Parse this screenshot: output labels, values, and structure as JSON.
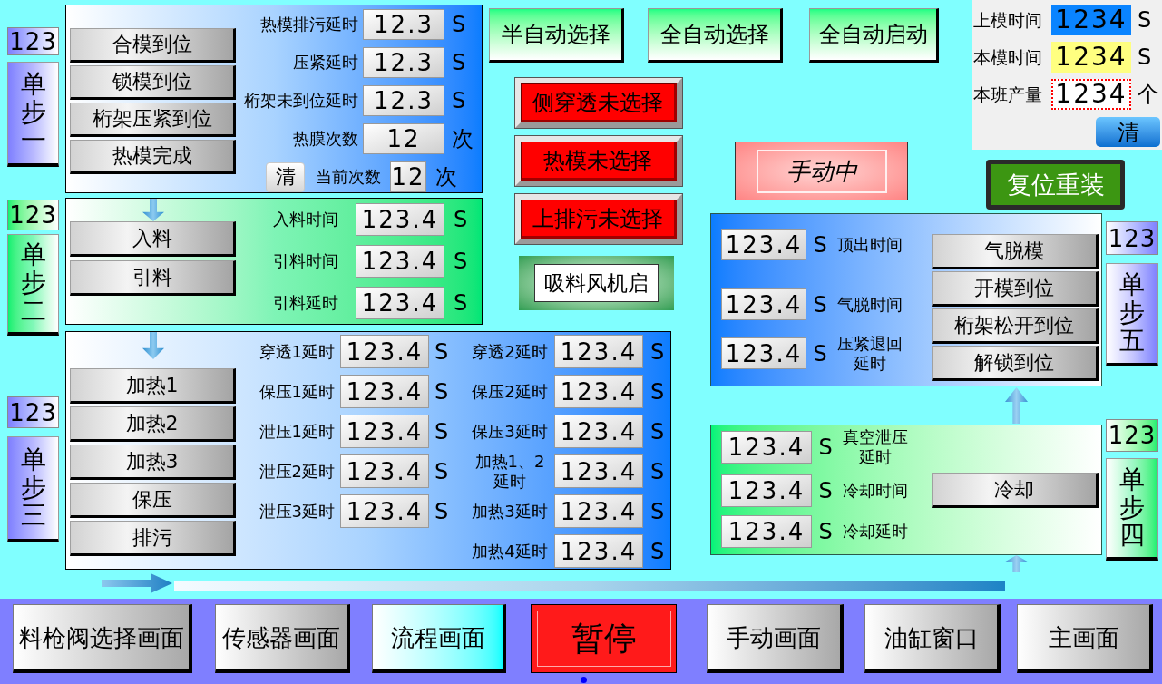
{
  "stage_1": {
    "step": {
      "display": "123",
      "label": "单步一"
    },
    "buttons": [
      "合模到位",
      "锁模到位",
      "桁架压紧到位",
      "热模完成"
    ],
    "params": [
      {
        "label": "热模排污延时",
        "value": "12.3",
        "unit": "S"
      },
      {
        "label": "压紧延时",
        "value": "12.3",
        "unit": "S"
      },
      {
        "label": "桁架未到位延时",
        "value": "12.3",
        "unit": "S"
      },
      {
        "label": "热膜次数",
        "value": "12",
        "unit": "次"
      }
    ],
    "counter": {
      "clear_button": "清",
      "label": "当前次数",
      "value": "12",
      "unit": "次"
    }
  },
  "stage_2": {
    "step": {
      "display": "123",
      "label": "单步二"
    },
    "buttons": [
      "入料",
      "引料"
    ],
    "params": [
      {
        "label": "入料时间",
        "value": "123.4",
        "unit": "S"
      },
      {
        "label": "引料时间",
        "value": "123.4",
        "unit": "S"
      },
      {
        "label": "引料延时",
        "value": "123.4",
        "unit": "S"
      }
    ]
  },
  "stage_3": {
    "step": {
      "display": "123",
      "label": "单步三"
    },
    "buttons": [
      "加热1",
      "加热2",
      "加热3",
      "保压",
      "排污"
    ],
    "params_left": [
      {
        "label": "穿透1延时",
        "value": "123.4",
        "unit": "S"
      },
      {
        "label": "保压1延时",
        "value": "123.4",
        "unit": "S"
      },
      {
        "label": "泄压1延时",
        "value": "123.4",
        "unit": "S"
      },
      {
        "label": "泄压2延时",
        "value": "123.4",
        "unit": "S"
      },
      {
        "label": "泄压3延时",
        "value": "123.4",
        "unit": "S"
      }
    ],
    "params_right": [
      {
        "label": "穿透2延时",
        "value": "123.4",
        "unit": "S"
      },
      {
        "label": "保压2延时",
        "value": "123.4",
        "unit": "S"
      },
      {
        "label": "保压3延时",
        "value": "123.4",
        "unit": "S"
      },
      {
        "label": "加热1、2延时",
        "value": "123.4",
        "unit": "S"
      },
      {
        "label": "加热3延时",
        "value": "123.4",
        "unit": "S"
      },
      {
        "label": "加热4延时",
        "value": "123.4",
        "unit": "S"
      }
    ]
  },
  "mode_buttons": [
    "半自动选择",
    "全自动选择",
    "全自动启动"
  ],
  "alarms": [
    "侧穿透未选择",
    "热模未选择",
    "上排污未选择"
  ],
  "fan_button": "吸料风机启",
  "status": "手动中",
  "production": {
    "rows": [
      {
        "label": "上模时间",
        "value": "1234",
        "unit": "S",
        "color": "#0a84ff",
        "focused": false
      },
      {
        "label": "本模时间",
        "value": "1234",
        "unit": "S",
        "color": "#ffff80",
        "focused": false
      },
      {
        "label": "本班产量",
        "value": "1234",
        "unit": "个",
        "color": "#ffffff",
        "focused": true
      }
    ],
    "clear_button": "清"
  },
  "reset_button": "复位重装",
  "stage_5": {
    "step": {
      "display": "123",
      "label": "单步五"
    },
    "params": [
      {
        "label": "顶出时间",
        "value": "123.4",
        "unit": "S"
      },
      {
        "label": "气脱时间",
        "value": "123.4",
        "unit": "S"
      },
      {
        "label": "压紧退回延时",
        "value": "123.4",
        "unit": "S"
      }
    ],
    "buttons": [
      "气脱模",
      "开模到位",
      "桁架松开到位",
      "解锁到位"
    ]
  },
  "stage_4": {
    "step": {
      "display": "123",
      "label": "单步四"
    },
    "params": [
      {
        "label": "真空泄压延时",
        "value": "123.4",
        "unit": "S"
      },
      {
        "label": "冷却时间",
        "value": "123.4",
        "unit": "S"
      },
      {
        "label": "冷却延时",
        "value": "123.4",
        "unit": "S"
      }
    ],
    "buttons": [
      "冷却"
    ]
  },
  "nav": [
    {
      "label": "料枪阀选择画面",
      "kind": "screen",
      "selected": false
    },
    {
      "label": "传感器画面",
      "kind": "screen",
      "selected": false
    },
    {
      "label": "流程画面",
      "kind": "screen",
      "selected": true
    },
    {
      "label": "暂停",
      "kind": "pause",
      "selected": false
    },
    {
      "label": "手动画面",
      "kind": "screen",
      "selected": false
    },
    {
      "label": "油缸窗口",
      "kind": "screen",
      "selected": false
    },
    {
      "label": "主画面",
      "kind": "screen",
      "selected": false
    }
  ]
}
